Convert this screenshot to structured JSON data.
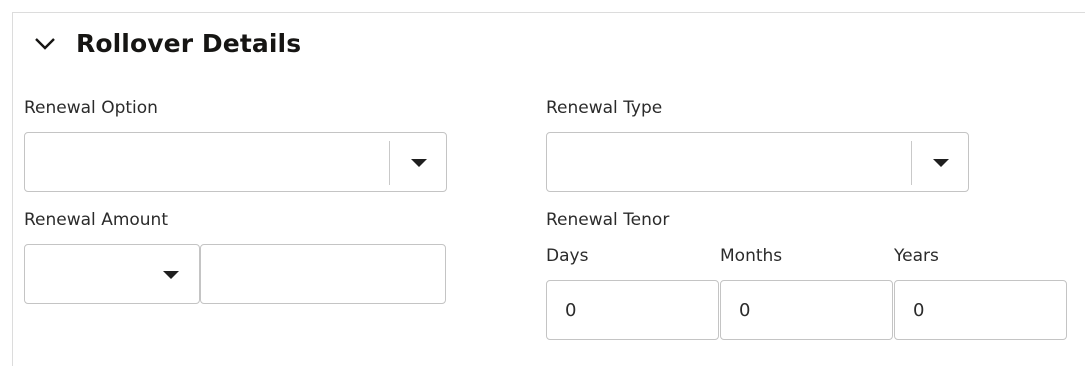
{
  "section": {
    "title": "Rollover Details"
  },
  "renewal_option": {
    "label": "Renewal Option",
    "value": ""
  },
  "renewal_type": {
    "label": "Renewal Type",
    "value": ""
  },
  "renewal_amount": {
    "label": "Renewal Amount",
    "currency": "",
    "amount": ""
  },
  "renewal_tenor": {
    "label": "Renewal Tenor",
    "days_label": "Days",
    "days_value": "0",
    "months_label": "Months",
    "months_value": "0",
    "years_label": "Years",
    "years_value": "0"
  }
}
